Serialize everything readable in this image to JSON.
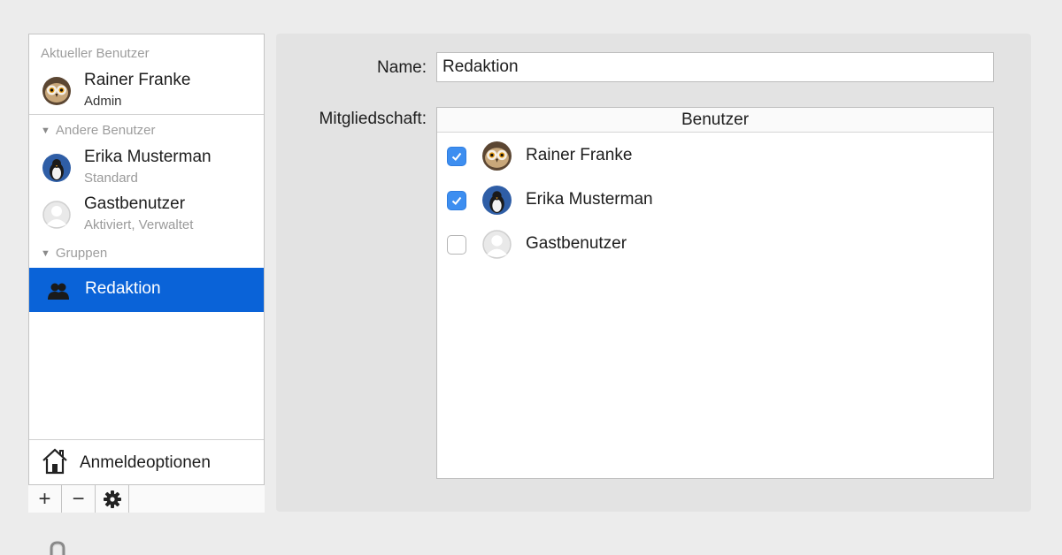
{
  "sidebar": {
    "current_header": "Aktueller Benutzer",
    "current_user": {
      "name": "Rainer Franke",
      "role": "Admin",
      "avatar": "owl-avatar-icon"
    },
    "other_header": "Andere Benutzer",
    "other_users": [
      {
        "name": "Erika Musterman",
        "role": "Standard",
        "avatar": "penguin-avatar-icon"
      },
      {
        "name": "Gastbenutzer",
        "role": "Aktiviert, Verwaltet",
        "avatar": "guest-avatar-icon"
      }
    ],
    "groups_header": "Gruppen",
    "groups": [
      {
        "name": "Redaktion",
        "icon": "group-icon",
        "selected": true
      }
    ],
    "login_options": "Anmeldeoptionen",
    "toolbar": {
      "add": "+",
      "remove": "−",
      "settings": "gear-icon"
    }
  },
  "main": {
    "name_label": "Name:",
    "name_value": "Redaktion",
    "membership_label": "Mitgliedschaft:",
    "table_header": "Benutzer",
    "members": [
      {
        "name": "Rainer Franke",
        "checked": true,
        "avatar": "owl-avatar-icon"
      },
      {
        "name": "Erika Musterman",
        "checked": true,
        "avatar": "penguin-avatar-icon"
      },
      {
        "name": "Gastbenutzer",
        "checked": false,
        "avatar": "guest-avatar-icon"
      }
    ]
  },
  "colors": {
    "selection": "#0a63d8",
    "checkbox": "#3d8ef0",
    "panel": "#e3e3e3",
    "window": "#ececec"
  }
}
